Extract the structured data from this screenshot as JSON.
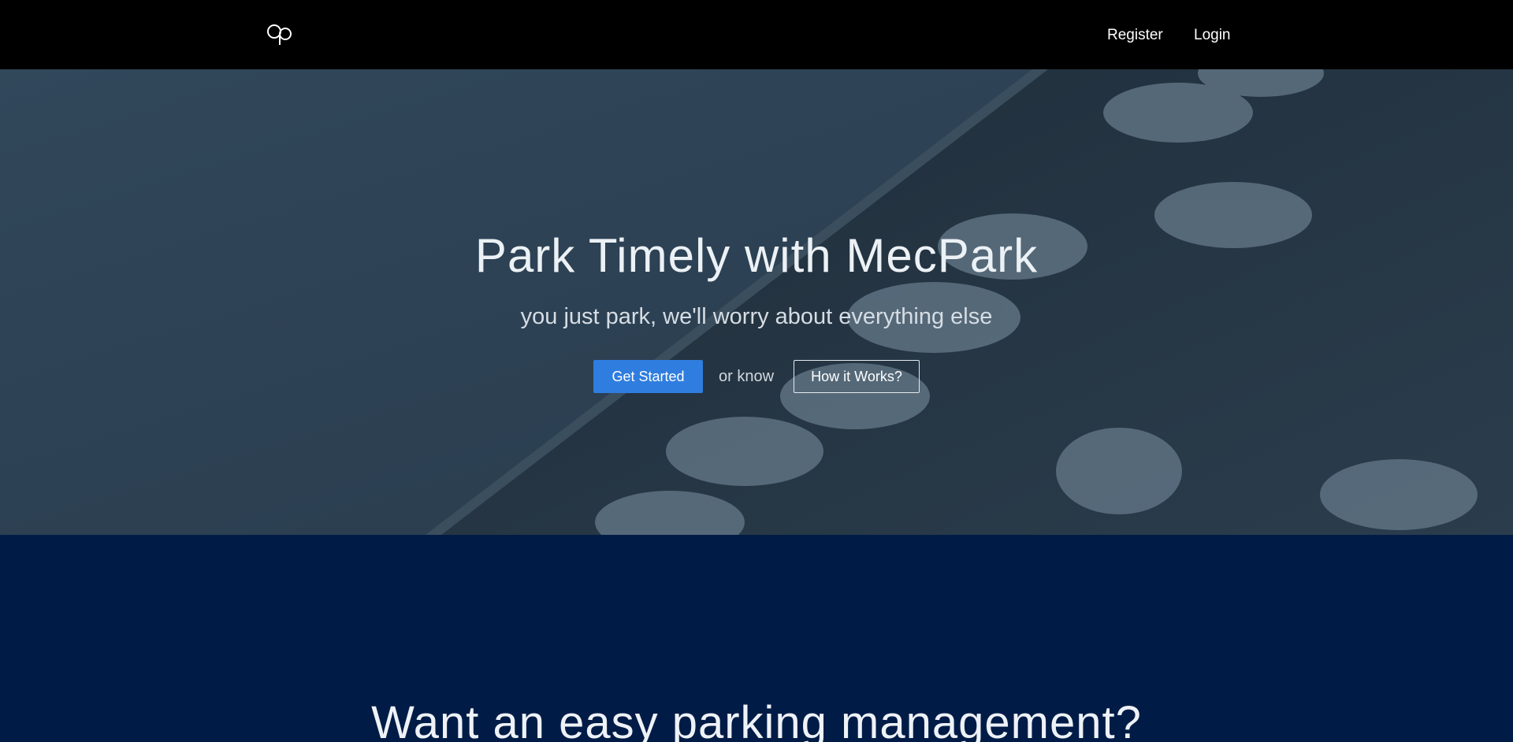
{
  "navbar": {
    "logo_icon": "mecpark-logo-icon",
    "links": {
      "register": "Register",
      "login": "Login"
    },
    "background": "#000000"
  },
  "hero": {
    "title": "Park Timely with MecPark",
    "subtitle": "you just park, we'll worry about everything else",
    "primary_button": "Get Started",
    "connector_text": "or know",
    "secondary_button": "How it Works?",
    "background_image": "aerial-parked-cars-photo",
    "accent_color": "#2f7ddf"
  },
  "section_two": {
    "heading": "Want an easy parking management?",
    "background": "#001c46"
  }
}
